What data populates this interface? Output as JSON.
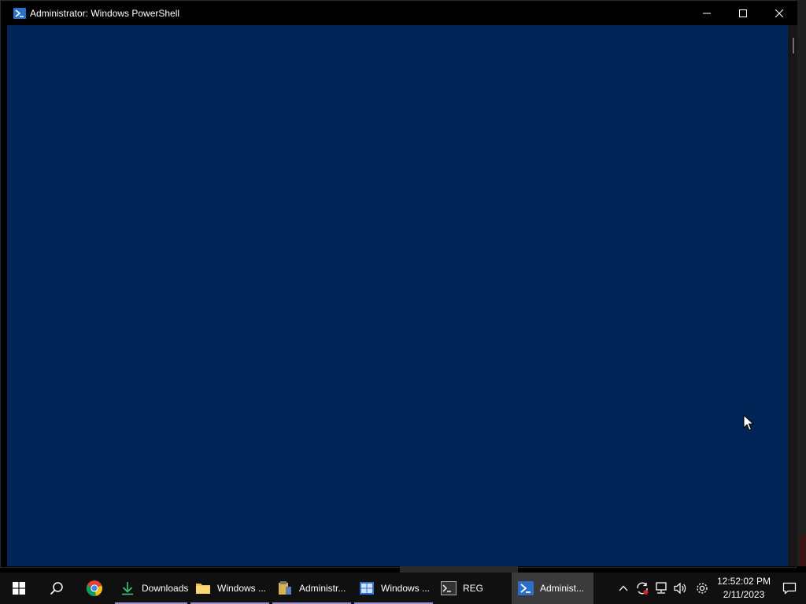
{
  "window": {
    "title": "Administrator: Windows PowerShell",
    "console_bg": "#012456"
  },
  "taskbar": {
    "apps": [
      {
        "name": "Downloads",
        "label": "Downloads",
        "icon": "download-arrow-icon"
      },
      {
        "name": "file-explorer",
        "label": "Windows ...",
        "icon": "folder-icon"
      },
      {
        "name": "admin-tools",
        "label": "Administr...",
        "icon": "admin-tools-icon"
      },
      {
        "name": "windows-app",
        "label": "Windows ...",
        "icon": "windows-logo-icon"
      },
      {
        "name": "reg",
        "label": "REG",
        "icon": "terminal-icon"
      },
      {
        "name": "powershell",
        "label": "Administ...",
        "icon": "powershell-icon"
      }
    ],
    "clock": {
      "time": "12:52:02 PM",
      "date": "2/11/2023"
    }
  },
  "colors": {
    "taskbar_bg": "#101010",
    "accent_underline": "#9b8fd1",
    "active_app_bg": "#3a3a3a"
  }
}
